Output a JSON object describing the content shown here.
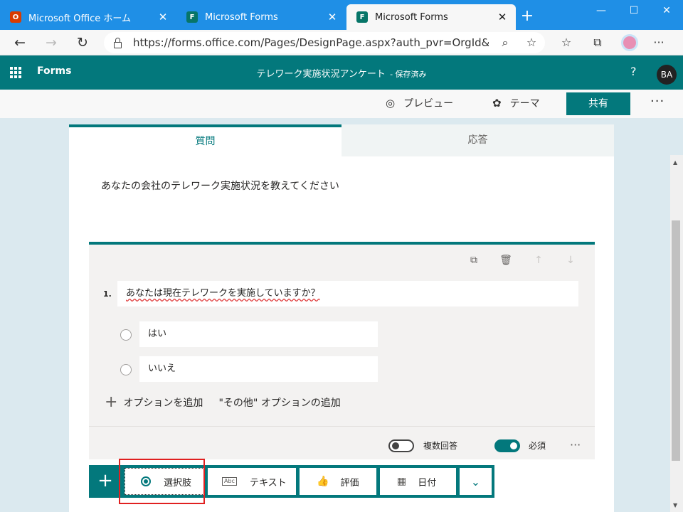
{
  "browser": {
    "tabs": [
      {
        "title": "Microsoft Office ホーム",
        "icon": "office-icon",
        "active": false
      },
      {
        "title": "Microsoft Forms",
        "icon": "forms-icon",
        "active": false
      },
      {
        "title": "Microsoft Forms",
        "icon": "forms-icon",
        "active": true
      }
    ],
    "url": "https://forms.office.com/Pages/DesignPage.aspx?auth_pvr=OrgId&a..."
  },
  "header": {
    "app_name": "Forms",
    "doc_title": "テレワーク実施状況アンケート",
    "saved_status": "- 保存済み",
    "help": "?",
    "avatar_initials": "BA"
  },
  "commands": {
    "preview": "プレビュー",
    "theme": "テーマ",
    "share": "共有",
    "more": "···"
  },
  "form": {
    "tabs": {
      "questions": "質問",
      "responses": "応答"
    },
    "description": "あなたの会社のテレワーク実施状況を教えてください",
    "question": {
      "number": "1.",
      "text": "あなたは現在テレワークを実施していますか？",
      "options": [
        "はい",
        "いいえ"
      ],
      "add_option": "オプションを追加",
      "add_other": "\"その他\" オプションの追加",
      "multi_answer_label": "複数回答",
      "multi_answer_on": false,
      "required_label": "必須",
      "required_on": true,
      "more": "···"
    }
  },
  "insert_bar": {
    "choice": "選択肢",
    "text": "テキスト",
    "rating": "評価",
    "date": "日付"
  },
  "colors": {
    "accent": "#03787c",
    "tabstrip": "#1f8fe6",
    "highlight": "#e02020"
  }
}
